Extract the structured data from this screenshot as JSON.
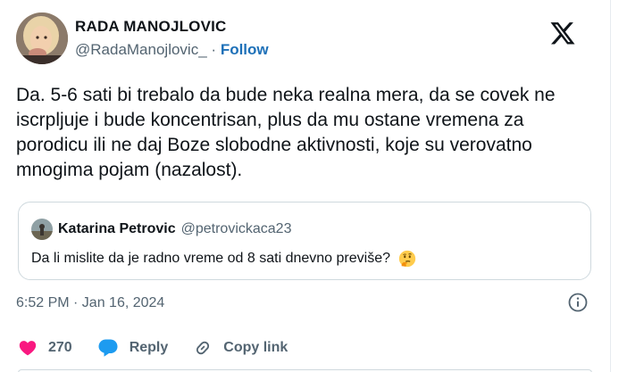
{
  "author": {
    "display_name": "RADA MANOJLOVIC",
    "handle": "@RadaManojlovic_",
    "separator": "·",
    "follow_label": "Follow"
  },
  "tweet": {
    "text": "Da. 5-6 sati bi trebalo da bude neka realna mera, da se covek ne iscrpljuje i bude koncentrisan, plus da mu ostane vremena za porodicu ili ne daj Boze slobodne aktivnosti, koje su verovatno mnogima pojam (nazalost).",
    "timestamp": "6:52 PM · Jan 16, 2024"
  },
  "quoted": {
    "name": "Katarina Petrovic",
    "handle": "@petrovickaca23",
    "text": "Da li mislite da je radno vreme od 8 sati dnevno previše?",
    "emoji_icon": "thinking-face-icon"
  },
  "actions": {
    "likes_count": "270",
    "reply_label": "Reply",
    "copy_link_label": "Copy link"
  },
  "colors": {
    "like_red": "#f91880",
    "reply_blue": "#1d9bf0",
    "follow_blue": "#1d70b8",
    "muted_gray": "#536471"
  },
  "icons": [
    "x-logo-icon",
    "info-icon",
    "heart-icon",
    "reply-bubble-icon",
    "link-icon"
  ]
}
